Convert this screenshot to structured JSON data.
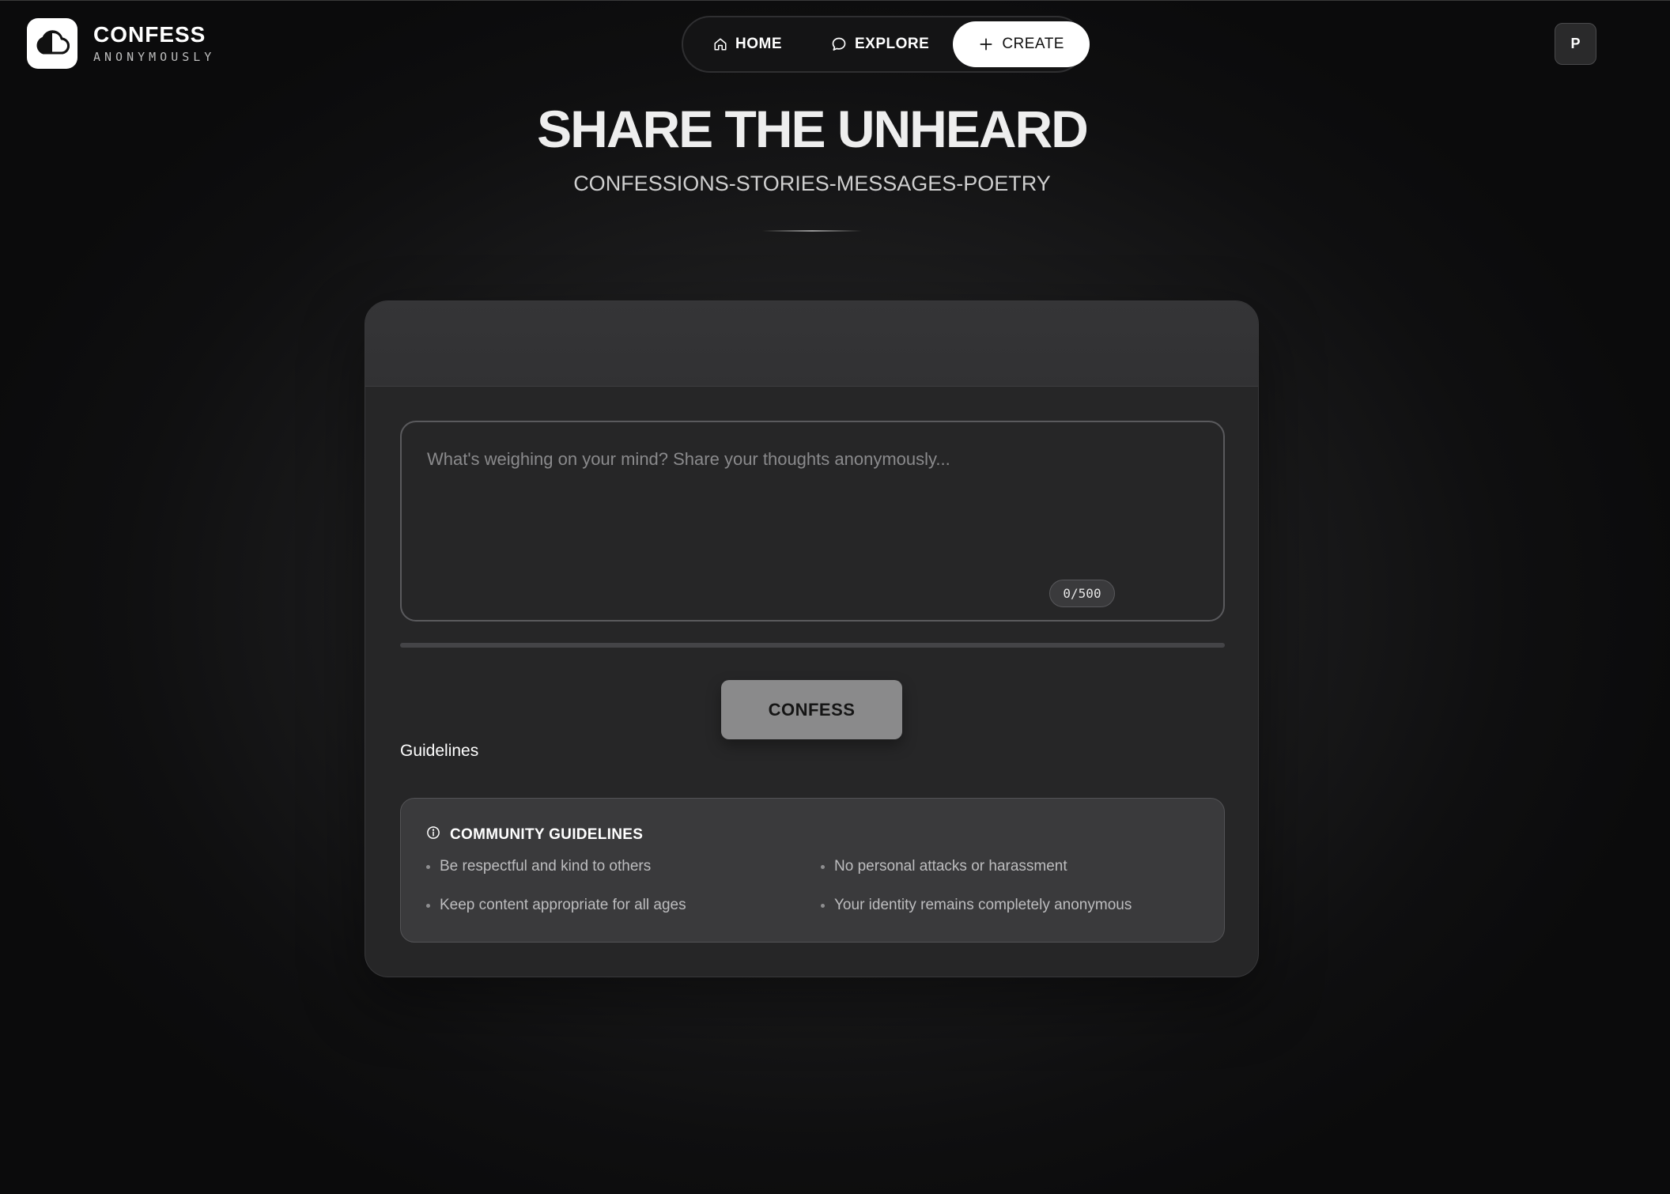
{
  "brand": {
    "title": "CONFESS",
    "subtitle": "ANONYMOUSLY",
    "logo_icon": "cloud-icon"
  },
  "nav": {
    "items": [
      {
        "label": "HOME",
        "icon": "home-icon"
      },
      {
        "label": "EXPLORE",
        "icon": "chat-bubble-icon"
      },
      {
        "label": "CREATE",
        "icon": "plus-icon",
        "active": true
      }
    ]
  },
  "user": {
    "avatar_initial": "P"
  },
  "hero": {
    "title": "SHARE THE UNHEARD",
    "subtitle": "CONFESSIONS-STORIES-MESSAGES-POETRY"
  },
  "composer": {
    "value": "",
    "placeholder": "What's weighing on your mind? Share your thoughts anonymously...",
    "counter": "0/500",
    "progress": 0,
    "submit_label": "CONFESS",
    "guidelines_label": "Guidelines"
  },
  "guidelines": {
    "icon": "info-icon",
    "title": "COMMUNITY GUIDELINES",
    "items": [
      "Be respectful and kind to others",
      "No personal attacks or harassment",
      "Keep content appropriate for all ages",
      "Your identity remains completely anonymous"
    ]
  },
  "colors": {
    "background": "#0f0f10",
    "card": "#262627",
    "accent": "#ffffff",
    "button": "#8a8a8b"
  }
}
